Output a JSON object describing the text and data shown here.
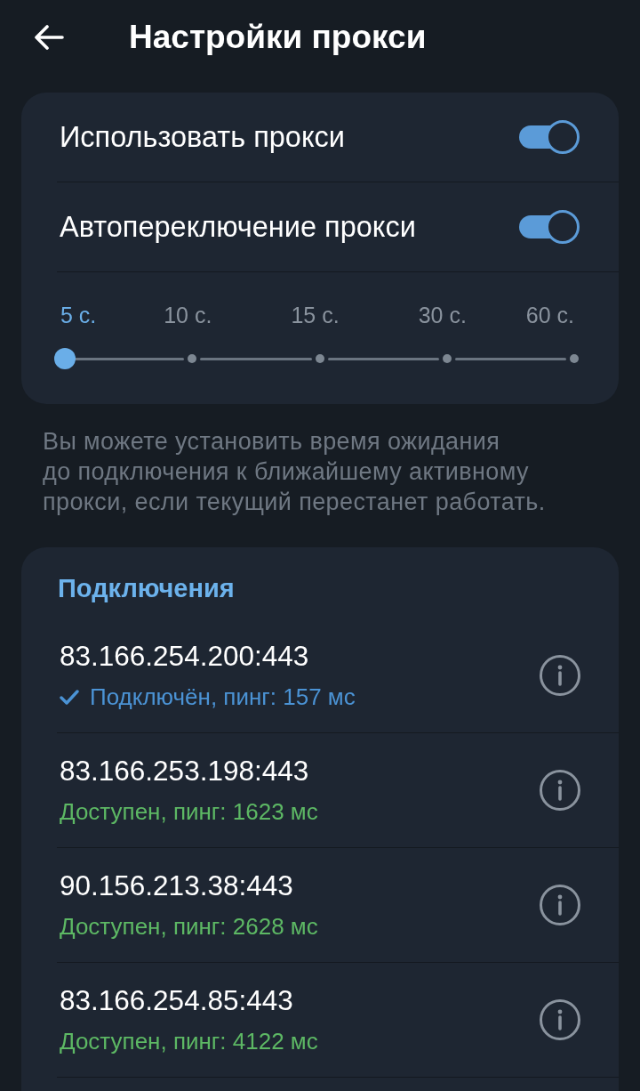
{
  "header": {
    "title": "Настройки прокси"
  },
  "settings": [
    {
      "label": "Использовать прокси",
      "on": true
    },
    {
      "label": "Автопереключение прокси",
      "on": true
    }
  ],
  "timeout_slider": {
    "level": 0,
    "stops": [
      {
        "label": "5 с.",
        "selected": true
      },
      {
        "label": "10 с.",
        "selected": false
      },
      {
        "label": "15 с.",
        "selected": false
      },
      {
        "label": "30 с.",
        "selected": false
      },
      {
        "label": "60 с.",
        "selected": false
      }
    ]
  },
  "hint": "Вы можете установить время ожидания\nдо подключения к ближайшему активному\nпрокси, если текущий перестанет работать.",
  "connections": {
    "title": "Подключения",
    "items": [
      {
        "address": "83.166.254.200:443",
        "status": "Подключён, пинг: 157 мс",
        "kind": "connected"
      },
      {
        "address": "83.166.253.198:443",
        "status": "Доступен, пинг: 1623 мс",
        "kind": "available"
      },
      {
        "address": "90.156.213.38:443",
        "status": "Доступен, пинг: 2628 мс",
        "kind": "available"
      },
      {
        "address": "83.166.254.85:443",
        "status": "Доступен, пинг: 4122 мс",
        "kind": "available"
      }
    ]
  }
}
